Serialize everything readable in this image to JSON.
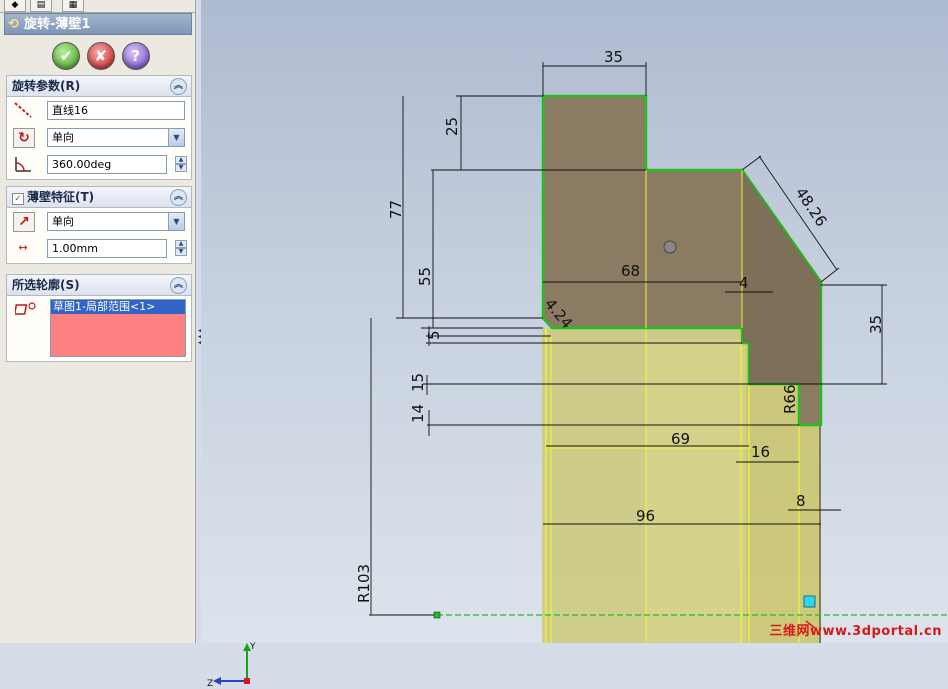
{
  "property_manager": {
    "title": "旋转-薄壁1",
    "buttons": {
      "ok": "✔",
      "cancel": "✘",
      "help": "?"
    },
    "group_rotate": {
      "title": "旋转参数(R)",
      "axis_value": "直线16",
      "direction_value": "单向",
      "angle_value": "360.00deg"
    },
    "group_thin": {
      "title": "薄壁特征(T)",
      "direction_value": "单向",
      "thickness_value": "1.00mm"
    },
    "group_contour": {
      "title": "所选轮廓(S)",
      "selected_item": "草图1-局部范围<1>"
    }
  },
  "icons": {
    "ok": "check-icon",
    "cancel": "x-icon",
    "help": "question-icon",
    "axis": "axis-line-icon",
    "direction": "reverse-direction-icon",
    "angle": "angle-icon",
    "thin_dir": "thin-direction-icon",
    "thickness": "thickness-icon",
    "contour": "contour-icon"
  },
  "dimensions": {
    "d35_top": "35",
    "d25": "25",
    "d77": "77",
    "d55": "55",
    "d48": "48.26",
    "d68": "68",
    "d4a": "4",
    "d424": "4.24",
    "d35_right": "35",
    "d5": "5",
    "d15": "15",
    "d14": "14",
    "dR66": "R66",
    "d69": "69",
    "d16": "16",
    "d8": "8",
    "d96": "96",
    "dR103": "R103"
  },
  "triad": {
    "y": "Y",
    "z": "Z"
  },
  "watermark": "三维网www.3dportal.cn",
  "colors": {
    "accent_title": "#7f97b8",
    "selection_bg": "#ff8080",
    "profile_green": "#22c01e",
    "section_fill": "#8a7a62",
    "revolve_fill": "#d4cf7a",
    "yellow_edge": "#e8ec3a"
  }
}
